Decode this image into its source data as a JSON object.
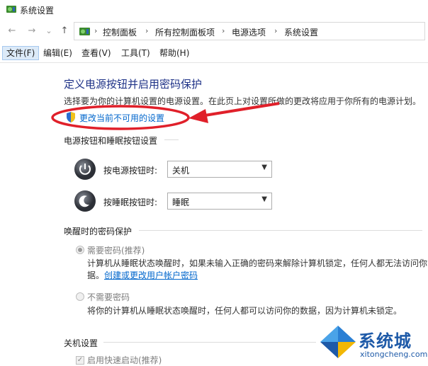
{
  "window": {
    "title": "系统设置",
    "title_icon": "control-panel-icon"
  },
  "nav": {
    "back": "←",
    "forward": "→",
    "dropdown": "⌄",
    "up": "↑"
  },
  "breadcrumb": [
    "控制面板",
    "所有控制面板项",
    "电源选项",
    "系统设置"
  ],
  "breadcrumb_separator": "›",
  "menu": [
    "文件(F)",
    "编辑(E)",
    "查看(V)",
    "工具(T)",
    "帮助(H)"
  ],
  "main": {
    "heading": "定义电源按钮并启用密码保护",
    "description": "选择要为你的计算机设置的电源设置。在此页上对设置所做的更改将应用于你所有的电源计划。",
    "change_link": "更改当前不可用的设置"
  },
  "power_section": {
    "title": "电源按钮和睡眠按钮设置",
    "power_row": {
      "label": "按电源按钮时:",
      "value": "关机"
    },
    "sleep_row": {
      "label": "按睡眠按钮时:",
      "value": "睡眠"
    }
  },
  "wake_section": {
    "title": "唤醒时的密码保护",
    "require": {
      "label": "需要密码(推荐)",
      "desc_line1": "计算机从睡眠状态唤醒时，如果未输入正确的密码来解除计算机锁定，任何人都无法访问你",
      "desc_line2_prefix": "据。",
      "desc_link": "创建或更改用户帐户密码"
    },
    "no_require": {
      "label": "不需要密码",
      "desc": "将你的计算机从睡眠状态唤醒时，任何人都可以访问你的数据，因为计算机未锁定。"
    }
  },
  "shutdown_section": {
    "title": "关机设置",
    "fast_startup": "启用快速启动(推荐)"
  },
  "watermark": {
    "brand": "系统城",
    "url": "xitongcheng.com"
  },
  "annotation": {
    "color": "#e0202a"
  }
}
